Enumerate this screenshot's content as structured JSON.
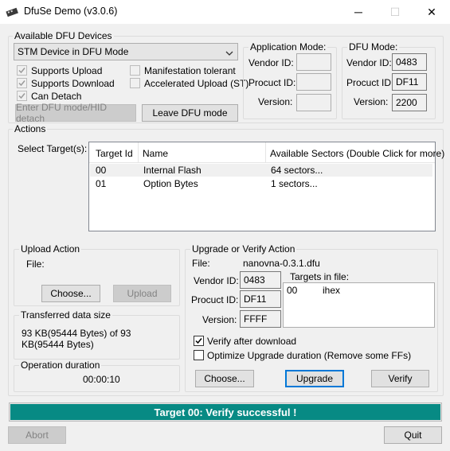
{
  "window": {
    "title": "DfuSe Demo (v3.0.6)",
    "minimize": "─",
    "maximize": "☐",
    "close": "✕"
  },
  "devices": {
    "group_label": "Available DFU Devices",
    "selected_device": "STM Device in DFU Mode",
    "supports_upload": "Supports Upload",
    "supports_download": "Supports Download",
    "can_detach": "Can Detach",
    "manifestation_tolerant": "Manifestation tolerant",
    "accelerated_upload": "Accelerated Upload (ST)",
    "enter_dfu_button": "Enter DFU mode/HID detach",
    "leave_dfu_button": "Leave DFU mode"
  },
  "app_mode": {
    "label": "Application Mode:",
    "vendor_id_label": "Vendor ID:",
    "product_id_label": "Procuct ID:",
    "version_label": "Version:",
    "vendor_id": "",
    "product_id": "",
    "version": ""
  },
  "dfu_mode": {
    "label": "DFU Mode:",
    "vendor_id_label": "Vendor ID:",
    "product_id_label": "Procuct ID:",
    "version_label": "Version:",
    "vendor_id": "0483",
    "product_id": "DF11",
    "version": "2200"
  },
  "actions": {
    "group_label": "Actions",
    "select_targets_label": "Select Target(s):",
    "columns": [
      "Target Id",
      "Name",
      "Available Sectors (Double Click for more)"
    ],
    "rows": [
      {
        "id": "00",
        "name": "Internal Flash",
        "sectors": "64 sectors..."
      },
      {
        "id": "01",
        "name": "Option Bytes",
        "sectors": "1 sectors..."
      }
    ]
  },
  "upload": {
    "group_label": "Upload Action",
    "file_label": "File:",
    "choose_button": "Choose...",
    "upload_button": "Upload"
  },
  "transferred": {
    "group_label": "Transferred data size",
    "text": "93 KB(95444 Bytes) of 93 KB(95444 Bytes)"
  },
  "duration": {
    "group_label": "Operation duration",
    "value": "00:00:10"
  },
  "upgrade": {
    "group_label": "Upgrade or Verify Action",
    "file_label": "File:",
    "file_name": "nanovna-0.3.1.dfu",
    "vendor_id_label": "Vendor ID:",
    "product_id_label": "Procuct ID:",
    "version_label": "Version:",
    "vendor_id": "0483",
    "product_id": "DF11",
    "version": "FFFF",
    "targets_in_file_label": "Targets in file:",
    "targets_in_file": [
      {
        "id": "00",
        "name": "ihex"
      }
    ],
    "verify_after_download": "Verify after download",
    "optimize_upgrade": "Optimize Upgrade duration (Remove some FFs)",
    "choose_button": "Choose...",
    "upgrade_button": "Upgrade",
    "verify_button": "Verify"
  },
  "status": {
    "message": "Target 00: Verify successful !",
    "progress": 1.0,
    "bar_color": "#078a84"
  },
  "footer": {
    "abort_button": "Abort",
    "quit_button": "Quit"
  }
}
